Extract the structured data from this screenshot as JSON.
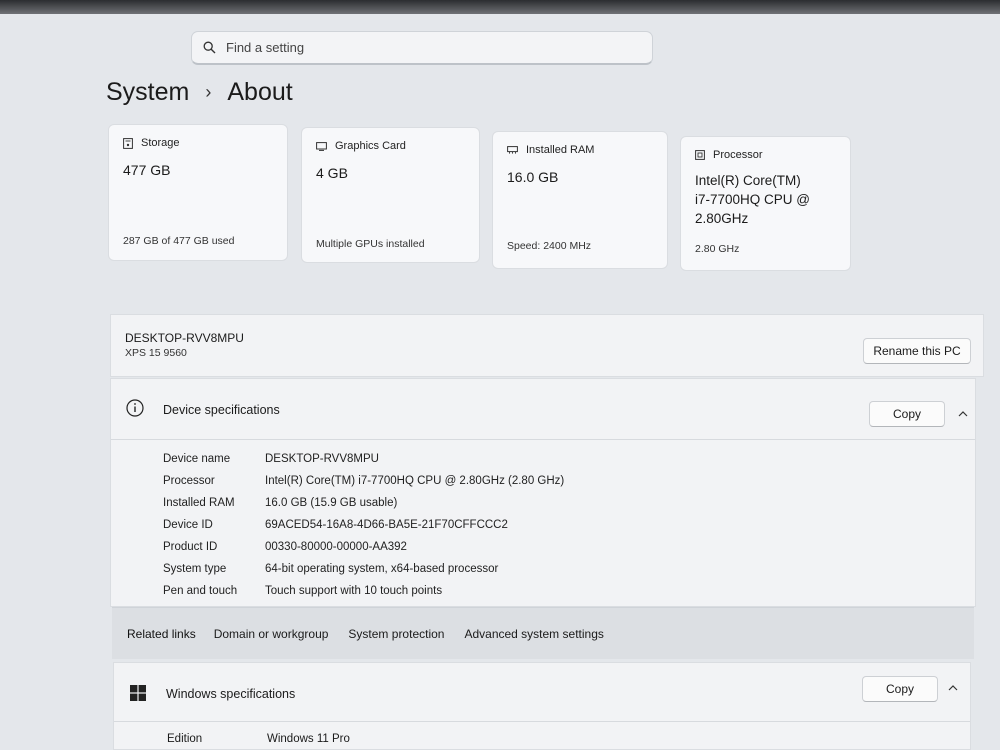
{
  "search": {
    "placeholder": "Find a setting"
  },
  "breadcrumb": {
    "parent": "System",
    "current": "About"
  },
  "cards": {
    "storage": {
      "label": "Storage",
      "value": "477 GB",
      "sub": "287 GB of 477 GB used"
    },
    "graphics": {
      "label": "Graphics Card",
      "value": "4 GB",
      "sub": "Multiple GPUs installed"
    },
    "ram": {
      "label": "Installed RAM",
      "value": "16.0 GB",
      "sub": "Speed: 2400 MHz"
    },
    "processor": {
      "label": "Processor",
      "value_lines": [
        "Intel(R) Core(TM)",
        "i7-7700HQ CPU @",
        "2.80GHz"
      ],
      "sub": "2.80 GHz"
    }
  },
  "device": {
    "name": "DESKTOP-RVV8MPU",
    "model": "XPS 15 9560",
    "rename_label": "Rename this PC"
  },
  "device_specs": {
    "title": "Device specifications",
    "copy_label": "Copy",
    "rows": [
      {
        "label": "Device name",
        "value": "DESKTOP-RVV8MPU"
      },
      {
        "label": "Processor",
        "value": "Intel(R) Core(TM) i7-7700HQ CPU @ 2.80GHz (2.80 GHz)"
      },
      {
        "label": "Installed RAM",
        "value": "16.0 GB (15.9 GB usable)"
      },
      {
        "label": "Device ID",
        "value": "69ACED54-16A8-4D66-BA5E-21F70CFFCCC2"
      },
      {
        "label": "Product ID",
        "value": "00330-80000-00000-AA392"
      },
      {
        "label": "System type",
        "value": "64-bit operating system, x64-based processor"
      },
      {
        "label": "Pen and touch",
        "value": "Touch support with 10 touch points"
      }
    ]
  },
  "related_links": {
    "title": "Related links",
    "items": [
      "Domain or workgroup",
      "System protection",
      "Advanced system settings"
    ]
  },
  "windows_specs": {
    "title": "Windows specifications",
    "copy_label": "Copy",
    "rows": [
      {
        "label": "Edition",
        "value": "Windows 11 Pro"
      }
    ]
  },
  "colors": {
    "background": "#e4e7eb",
    "card": "#f7f8fa",
    "links_band": "#dcdfe3"
  },
  "icons": {
    "search": "search-icon",
    "storage": "storage-icon",
    "graphics": "graphics-card-icon",
    "ram": "ram-icon",
    "processor": "processor-icon",
    "info": "info-icon",
    "windows": "windows-logo-icon",
    "chevron": "chevron-up-icon"
  }
}
